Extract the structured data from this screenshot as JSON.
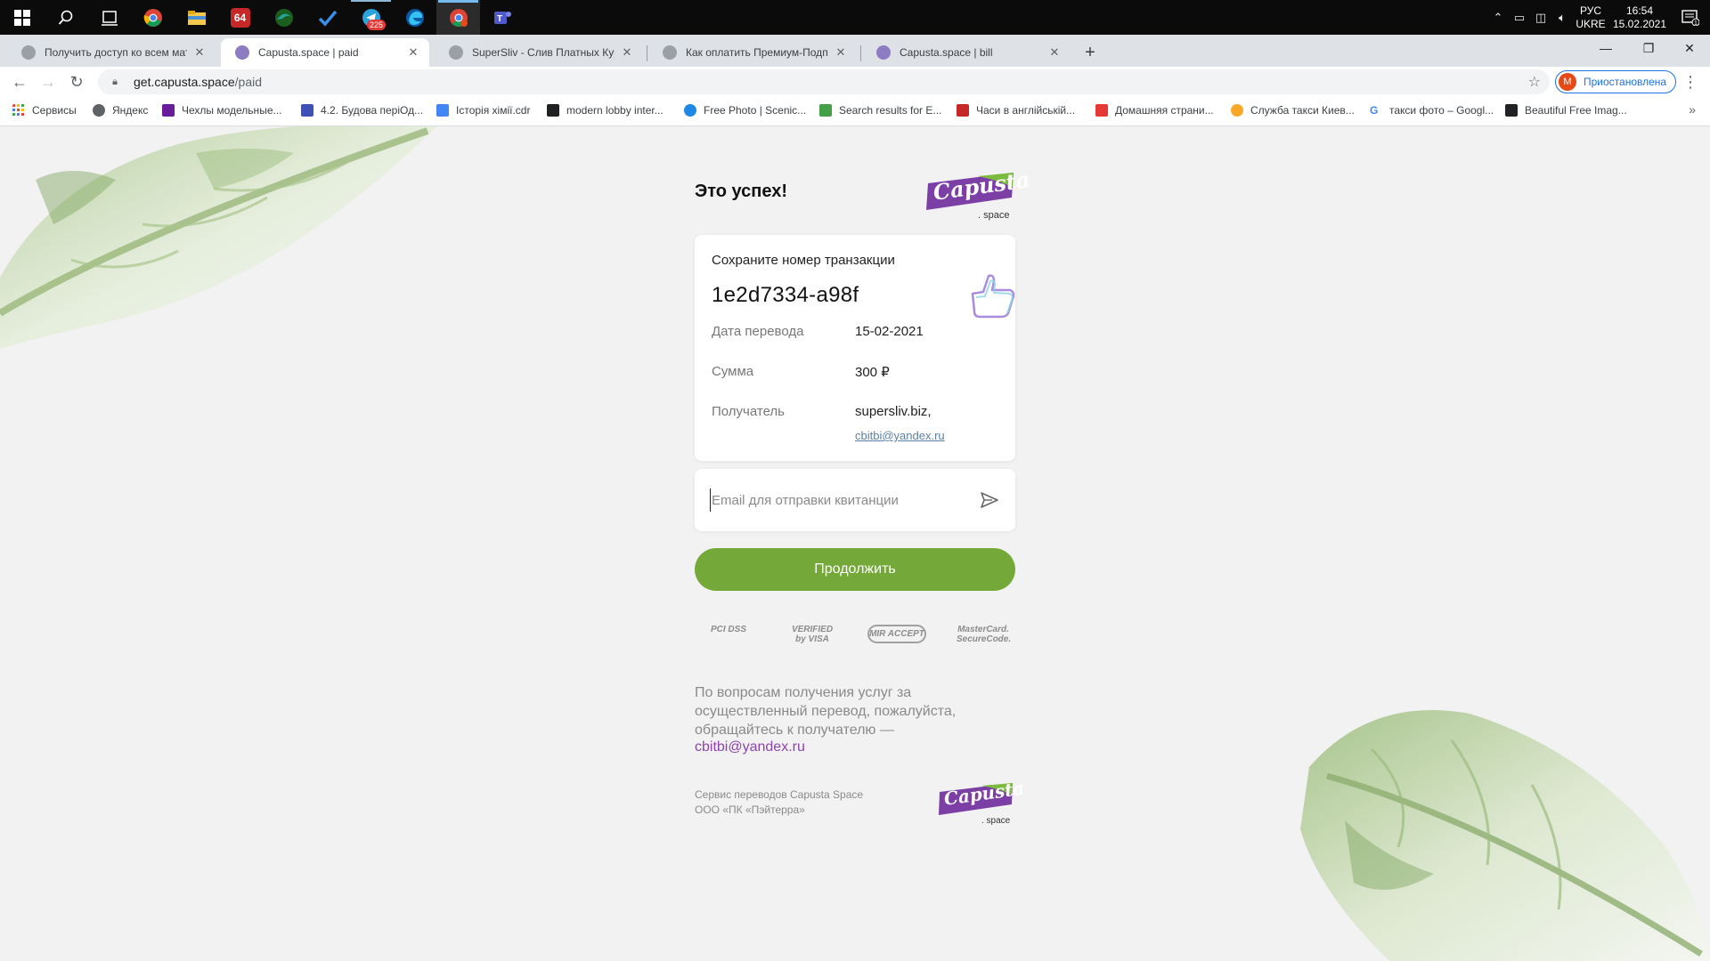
{
  "taskbar": {
    "icons": [
      {
        "name": "windows-start-icon"
      },
      {
        "name": "search-icon"
      },
      {
        "name": "task-view-icon"
      },
      {
        "name": "chrome-icon"
      },
      {
        "name": "file-explorer-icon"
      },
      {
        "name": "aida64-icon",
        "label": "64"
      },
      {
        "name": "edge-dev-icon"
      },
      {
        "name": "todo-icon"
      },
      {
        "name": "telegram-icon",
        "badge": "225"
      },
      {
        "name": "edge-icon"
      },
      {
        "name": "chrome-profile-icon"
      },
      {
        "name": "teams-icon"
      }
    ],
    "lang_top": "РУС",
    "lang_bottom": "UKRE",
    "time": "16:54",
    "date": "15.02.2021",
    "notification_count": "1"
  },
  "tabs": [
    {
      "title": "Получить доступ ко всем матер",
      "favicon_color": "#9aa0a6",
      "active": false
    },
    {
      "title": "Capusta.space | paid",
      "favicon_color": "#8e7cc3",
      "active": true
    },
    {
      "title": "SuperSliv - Слив Платных Курсо",
      "favicon_color": "#9aa0a6",
      "active": false
    },
    {
      "title": "Как оплатить Премиум-Подпис",
      "favicon_color": "#9aa0a6",
      "active": false
    },
    {
      "title": "Capusta.space | bill",
      "favicon_color": "#8e7cc3",
      "active": false
    }
  ],
  "address": {
    "host": "get.capusta.space",
    "path": "/paid",
    "profile_initial": "M",
    "profile_status": "Приостановлена"
  },
  "bookmarks": [
    {
      "label": "Сервисы",
      "color": "#ea4335"
    },
    {
      "label": "Яндекс",
      "color": "#5f6368"
    },
    {
      "label": "Чехлы модельные...",
      "color": "#6a1b9a"
    },
    {
      "label": "4.2. Будова періОд...",
      "color": "#3f51b5"
    },
    {
      "label": "Історія хімії.cdr",
      "color": "#4285f4"
    },
    {
      "label": "modern lobby inter...",
      "color": "#202124"
    },
    {
      "label": "Free Photo | Scenic...",
      "color": "#1e88e5"
    },
    {
      "label": "Search results for E...",
      "color": "#43a047"
    },
    {
      "label": "Часи в англійській...",
      "color": "#c62828"
    },
    {
      "label": "Домашняя страни...",
      "color": "#e53935"
    },
    {
      "label": "Служба такси Киев...",
      "color": "#f9a825"
    },
    {
      "label": "такси фото – Googl...",
      "color": "#4285f4"
    },
    {
      "label": "Beautiful Free Imag...",
      "color": "#202124"
    }
  ],
  "page": {
    "heading": "Это успех!",
    "logo_brand": "Capusta",
    "logo_sub": ". space",
    "save_label": "Сохраните номер транзакции",
    "transaction_id": "1e2d7334-a98f",
    "rows": [
      {
        "label": "Дата перевода",
        "value": "15-02-2021"
      },
      {
        "label": "Сумма",
        "value": "300 ₽"
      },
      {
        "label": "Получатель",
        "value": "supersliv.biz,"
      }
    ],
    "recipient_email": "cbitbi@yandex.ru",
    "email_placeholder": "Email для отправки квитанции",
    "continue_label": "Продолжить",
    "payment_logos": [
      "PCI DSS",
      "VERIFIED by VISA",
      "MIR ACCEPT",
      "MasterCard. SecureCode."
    ],
    "info_text": "По вопросам получения услуг за осуществленный перевод, пожалуйста, обращайтесь к получателю —",
    "info_email": "cbitbi@yandex.ru",
    "footer_line1": "Сервис переводов Capusta Space",
    "footer_line2": "ООО «ПК «Пэйтерра»"
  },
  "colors": {
    "accent_green": "#74a93a",
    "logo_purple": "#7c3fa6",
    "logo_green": "#7dbb3f",
    "email_link": "#8e44ad"
  }
}
